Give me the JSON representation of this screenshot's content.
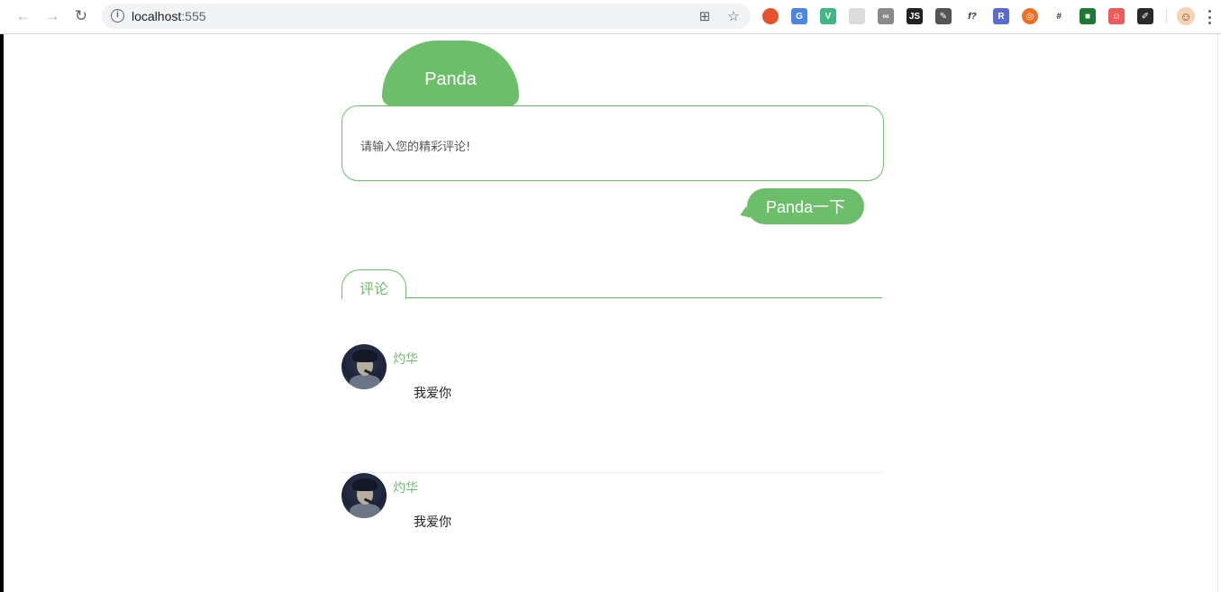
{
  "browser": {
    "url_host": "localhost",
    "url_port": ":555",
    "back_icon": "←",
    "forward_icon": "→",
    "reload_icon": "↻",
    "info_icon": "i",
    "translate_icon": "⊞",
    "star_icon": "☆",
    "extensions": [
      {
        "name": "ext-orange-ball-icon",
        "glyph": "",
        "color": "#e8532b"
      },
      {
        "name": "ext-google-translate-icon",
        "glyph": "G",
        "color": "#4a86e8"
      },
      {
        "name": "ext-vue-devtools-icon",
        "glyph": "V",
        "color": "#41b883"
      },
      {
        "name": "ext-grey-grid-icon",
        "glyph": "",
        "color": "#dcdcdc"
      },
      {
        "name": "ext-link-icon",
        "glyph": "∞",
        "color": "#8a8a8a"
      },
      {
        "name": "ext-js-icon",
        "glyph": "JS",
        "color": "#222222"
      },
      {
        "name": "ext-eyedropper-icon",
        "glyph": "✎",
        "color": "#555555"
      },
      {
        "name": "ext-fonts-icon",
        "glyph": "f?",
        "color": "#ffffff"
      },
      {
        "name": "ext-react-icon",
        "glyph": "R",
        "color": "#5b6ad0"
      },
      {
        "name": "ext-orange-circle-icon",
        "glyph": "◎",
        "color": "#f06f23"
      },
      {
        "name": "ext-grid-hash-icon",
        "glyph": "#",
        "color": "#ffffff"
      },
      {
        "name": "ext-green-square-icon",
        "glyph": "■",
        "color": "#1e7b34"
      },
      {
        "name": "ext-octocat-icon",
        "glyph": "☺",
        "color": "#ef5a5a"
      },
      {
        "name": "ext-paint-icon",
        "glyph": "✐",
        "color": "#2a2a2a"
      }
    ],
    "profile_icon": "☺"
  },
  "page": {
    "name_tab": "Panda",
    "input_placeholder": "请输入您的精彩评论!",
    "submit_label": "Panda一下",
    "section_title": "评论",
    "accent_color": "#6dbe6a",
    "comments": [
      {
        "user": "灼华",
        "text": "我爱你"
      },
      {
        "user": "灼华",
        "text": "我爱你"
      }
    ]
  }
}
